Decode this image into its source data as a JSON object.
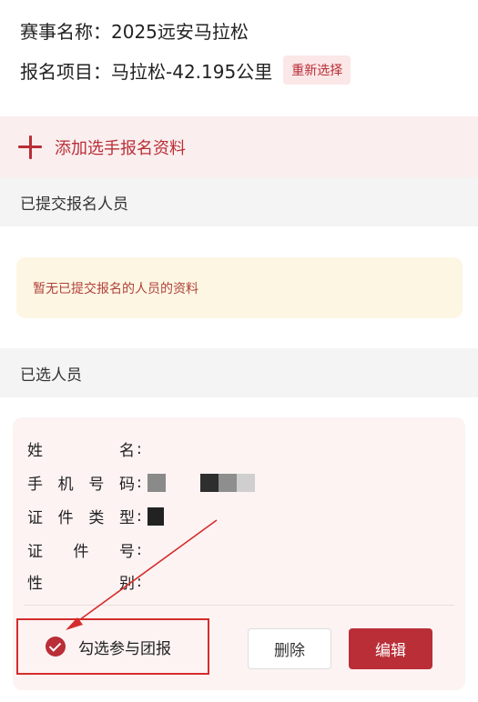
{
  "event": {
    "name_label": "赛事名称：",
    "name_value": "2025远安马拉松",
    "item_label": "报名项目：",
    "item_value": "马拉松-42.195公里",
    "reselect_label": "重新选择"
  },
  "add_runner": {
    "label": "添加选手报名资料"
  },
  "submitted": {
    "heading": "已提交报名人员",
    "empty_text": "暂无已提交报名的人员的资料"
  },
  "selected": {
    "heading": "已选人员",
    "fields": [
      {
        "label": [
          "姓",
          "名"
        ],
        "value": ""
      },
      {
        "label": [
          "手",
          "机",
          "号",
          "码"
        ],
        "value": ""
      },
      {
        "label": [
          "证",
          "件",
          "类",
          "型"
        ],
        "value": ""
      },
      {
        "label": [
          "证",
          "件",
          "号"
        ],
        "value": ""
      },
      {
        "label": [
          "性",
          "别"
        ],
        "value": ""
      }
    ],
    "colon": ":",
    "group_check_label": "勾选参与团报",
    "group_checked": true,
    "delete_label": "删除",
    "edit_label": "编辑"
  },
  "colors": {
    "accent": "#b92e37",
    "notice_bg": "#fdf6e3",
    "annotation": "#d42c2c"
  },
  "icons": [
    "plus-icon",
    "check-circle-icon",
    "annotation-arrow"
  ]
}
